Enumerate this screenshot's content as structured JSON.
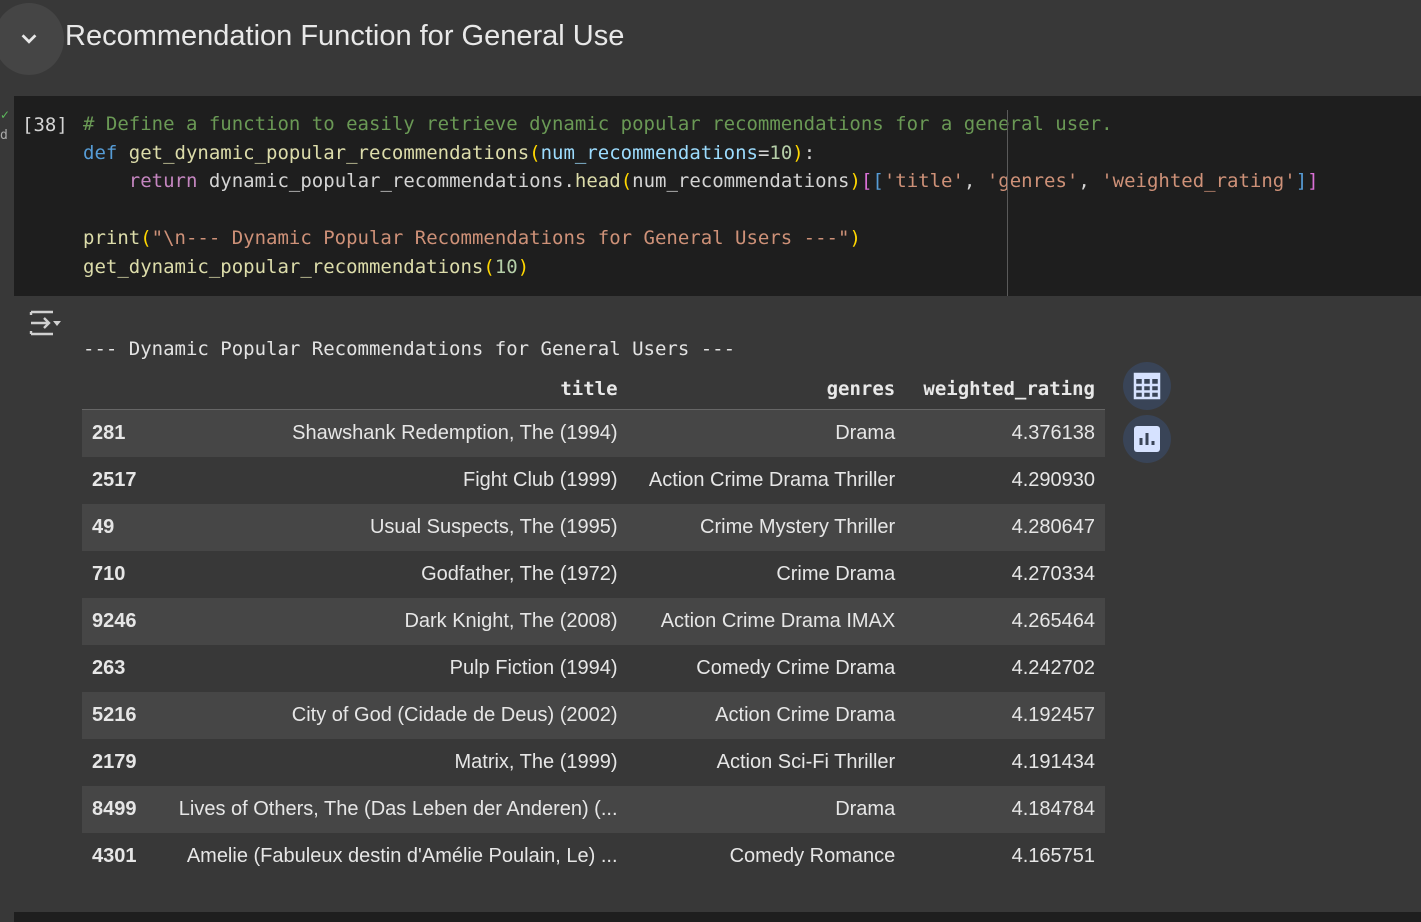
{
  "section": {
    "title": "Recommendation Function for General Use"
  },
  "cell": {
    "number": "[38]",
    "status_text": "d",
    "code": {
      "comment": "# Define a function to easily retrieve dynamic popular recommendations for a general user.",
      "def_kw": "def",
      "func_name": "get_dynamic_popular_recommendations",
      "param": "num_recommendations",
      "default": "10",
      "return_kw": "return",
      "obj": "dynamic_popular_recommendations",
      "method": "head",
      "col1": "'title'",
      "col2": "'genres'",
      "col3": "'weighted_rating'",
      "print_fn": "print",
      "print_str": "\"\\n--- Dynamic Popular Recommendations for General Users ---\"",
      "call_arg": "10"
    }
  },
  "output": {
    "printed": "--- Dynamic Popular Recommendations for General Users ---",
    "columns": [
      "",
      "title",
      "genres",
      "weighted_rating"
    ],
    "rows": [
      {
        "idx": "281",
        "title": "Shawshank Redemption, The (1994)",
        "genres": "Drama",
        "rating": "4.376138"
      },
      {
        "idx": "2517",
        "title": "Fight Club (1999)",
        "genres": "Action Crime Drama Thriller",
        "rating": "4.290930"
      },
      {
        "idx": "49",
        "title": "Usual Suspects, The (1995)",
        "genres": "Crime Mystery Thriller",
        "rating": "4.280647"
      },
      {
        "idx": "710",
        "title": "Godfather, The (1972)",
        "genres": "Crime Drama",
        "rating": "4.270334"
      },
      {
        "idx": "9246",
        "title": "Dark Knight, The (2008)",
        "genres": "Action Crime Drama IMAX",
        "rating": "4.265464"
      },
      {
        "idx": "263",
        "title": "Pulp Fiction (1994)",
        "genres": "Comedy Crime Drama",
        "rating": "4.242702"
      },
      {
        "idx": "5216",
        "title": "City of God (Cidade de Deus) (2002)",
        "genres": "Action Crime Drama",
        "rating": "4.192457"
      },
      {
        "idx": "2179",
        "title": "Matrix, The (1999)",
        "genres": "Action Sci-Fi Thriller",
        "rating": "4.191434"
      },
      {
        "idx": "8499",
        "title": "Lives of Others, The (Das Leben der Anderen) (...",
        "genres": "Drama",
        "rating": "4.184784"
      },
      {
        "idx": "4301",
        "title": "Amelie (Fabuleux destin d'Amélie Poulain, Le) ...",
        "genres": "Comedy Romance",
        "rating": "4.165751"
      }
    ]
  }
}
